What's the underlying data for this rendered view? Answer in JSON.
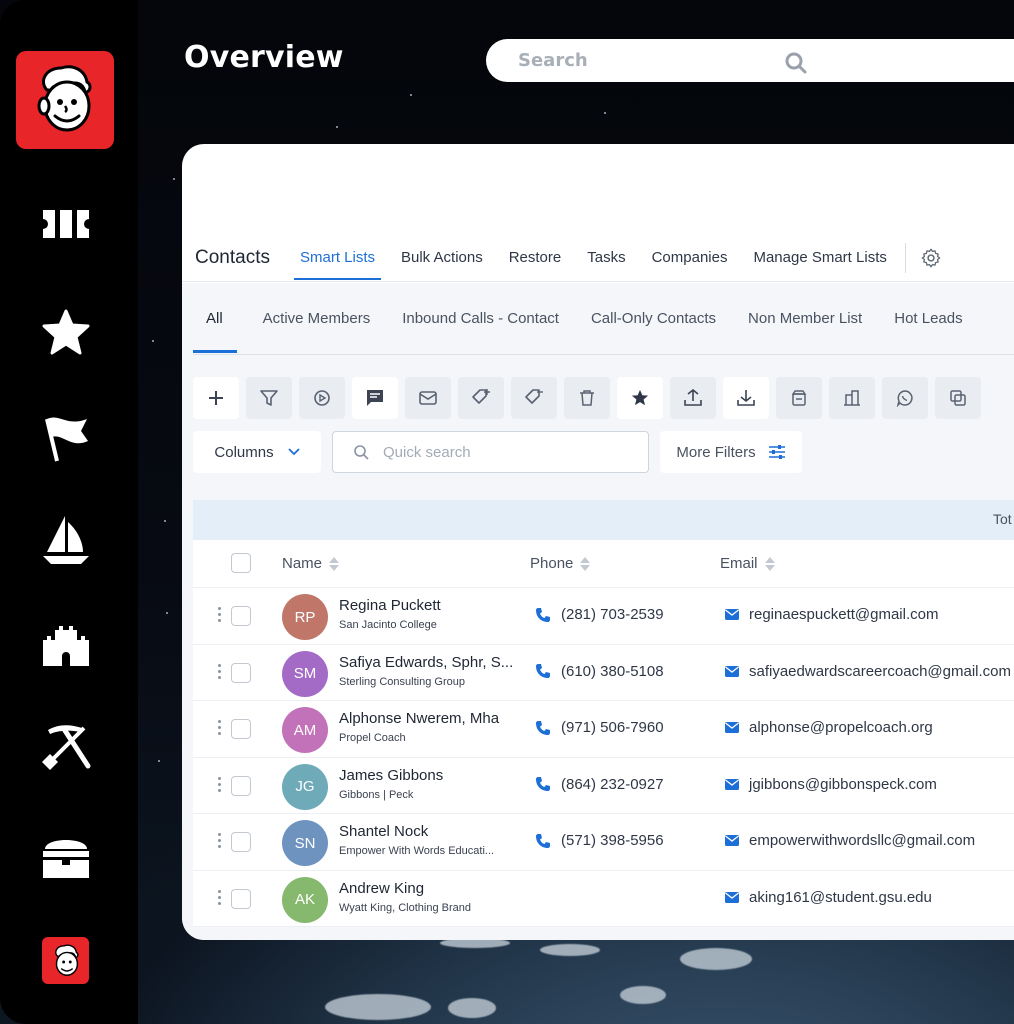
{
  "app": {
    "title": "Overview",
    "search_placeholder": "Search"
  },
  "sidebar": {
    "items": [
      {
        "icon": "ticket-icon"
      },
      {
        "icon": "star-icon"
      },
      {
        "icon": "flag-icon"
      },
      {
        "icon": "sailboat-icon"
      },
      {
        "icon": "castle-icon"
      },
      {
        "icon": "pickaxe-shovel-icon"
      },
      {
        "icon": "treasure-chest-icon"
      }
    ]
  },
  "nav": {
    "brand": "Contacts",
    "tabs": [
      "Smart Lists",
      "Bulk Actions",
      "Restore",
      "Tasks",
      "Companies",
      "Manage Smart Lists"
    ],
    "active_tab": "Smart Lists"
  },
  "smart_lists": {
    "tabs": [
      "All",
      "Active Members",
      "Inbound Calls - Contact",
      "Call-Only Contacts",
      "Non Member List",
      "Hot Leads"
    ],
    "active": "All"
  },
  "toolbar": {
    "icons": [
      "plus-icon",
      "filter-icon",
      "workflow-icon",
      "message-icon",
      "email-icon",
      "add-tag-icon",
      "remove-tag-icon",
      "trash-icon",
      "star-icon",
      "export-icon",
      "import-icon",
      "archive-icon",
      "company-icon",
      "whatsapp-icon",
      "merge-icon"
    ]
  },
  "filters": {
    "columns_label": "Columns",
    "quick_search_placeholder": "Quick search",
    "more_filters_label": "More Filters"
  },
  "total_label": "Tot",
  "table": {
    "headers": {
      "name": "Name",
      "phone": "Phone",
      "email": "Email"
    },
    "rows": [
      {
        "initials": "RP",
        "name": "Regina Puckett",
        "company": "San Jacinto College",
        "phone": "(281) 703-2539",
        "email": "reginaespuckett@gmail.com",
        "color": "#c0776a"
      },
      {
        "initials": "SM",
        "name": "Safiya Edwards, Sphr, S...",
        "company": "Sterling Consulting Group",
        "phone": "(610) 380-5108",
        "email": "safiyaedwardscareercoach@gmail.com",
        "color": "#a46bc6"
      },
      {
        "initials": "AM",
        "name": "Alphonse Nwerem, Mha",
        "company": "Propel Coach",
        "phone": "(971) 506-7960",
        "email": "alphonse@propelcoach.org",
        "color": "#c272b8"
      },
      {
        "initials": "JG",
        "name": "James Gibbons",
        "company": "Gibbons | Peck",
        "phone": "(864) 232-0927",
        "email": "jgibbons@gibbonspeck.com",
        "color": "#6eaab8"
      },
      {
        "initials": "SN",
        "name": "Shantel Nock",
        "company": "Empower With Words Educati...",
        "phone": "(571) 398-5956",
        "email": "empowerwithwordsllc@gmail.com",
        "color": "#6e93bf"
      },
      {
        "initials": "AK",
        "name": "Andrew King",
        "company": "Wyatt King, Clothing Brand",
        "phone": "",
        "email": "aking161@student.gsu.edu",
        "color": "#86b86e"
      }
    ]
  },
  "colors": {
    "brand_red": "#e8262a",
    "accent_blue": "#1d6fd8"
  }
}
